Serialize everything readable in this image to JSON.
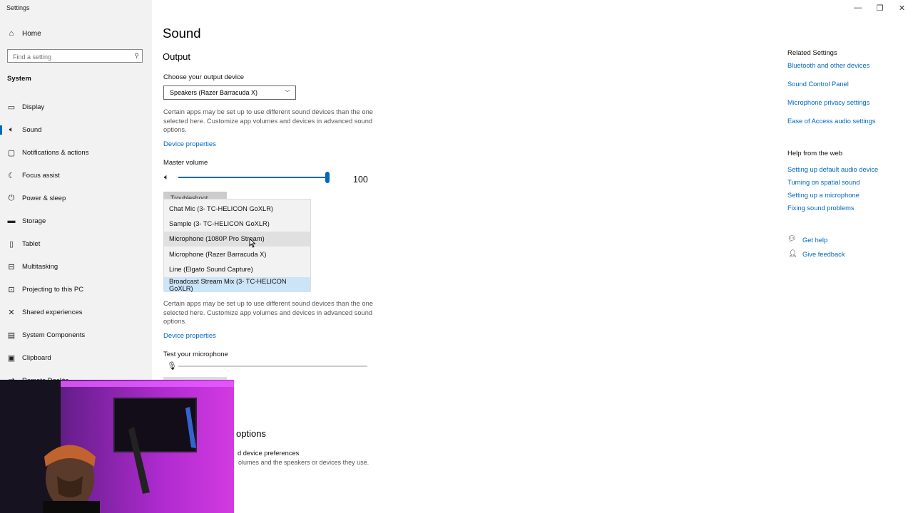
{
  "window": {
    "title": "Settings",
    "controls": {
      "minimize": "—",
      "restore": "❐",
      "close": "✕"
    }
  },
  "sidebar": {
    "home": {
      "icon": "home-icon",
      "label": "Home"
    },
    "search": {
      "placeholder": "Find a setting",
      "icon": "search-icon"
    },
    "section": "System",
    "items": [
      {
        "icon": "display-icon",
        "label": "Display"
      },
      {
        "icon": "sound-icon",
        "label": "Sound",
        "active": true
      },
      {
        "icon": "notifications-icon",
        "label": "Notifications & actions"
      },
      {
        "icon": "focus-assist-icon",
        "label": "Focus assist"
      },
      {
        "icon": "power-icon",
        "label": "Power & sleep"
      },
      {
        "icon": "storage-icon",
        "label": "Storage"
      },
      {
        "icon": "tablet-icon",
        "label": "Tablet"
      },
      {
        "icon": "multitasking-icon",
        "label": "Multitasking"
      },
      {
        "icon": "projecting-icon",
        "label": "Projecting to this PC"
      },
      {
        "icon": "shared-experiences-icon",
        "label": "Shared experiences"
      },
      {
        "icon": "system-components-icon",
        "label": "System Components"
      },
      {
        "icon": "clipboard-icon",
        "label": "Clipboard"
      },
      {
        "icon": "remote-desktop-icon",
        "label": "Remote Deskto"
      }
    ]
  },
  "main": {
    "title": "Sound",
    "output": {
      "heading": "Output",
      "device_label": "Choose your output device",
      "device_value": "Speakers (Razer Barracuda X)",
      "description": "Certain apps may be set up to use different sound devices than the one selected here. Customize app volumes and devices in advanced sound options.",
      "device_properties": "Device properties",
      "master_volume_label": "Master volume",
      "master_volume_value": "100",
      "master_volume_level": 1.0,
      "troubleshoot_label": "Troubleshoot"
    },
    "input_dropdown": {
      "options": [
        "Chat Mic (3- TC-HELICON GoXLR)",
        "Sample (3- TC-HELICON GoXLR)",
        "Microphone (1080P Pro Stream)",
        "Microphone (Razer Barracuda X)",
        "Line (Elgato Sound Capture)",
        "Broadcast Stream Mix (3- TC-HELICON GoXLR)"
      ],
      "hovered_index": 2,
      "selected_index": 5
    },
    "input": {
      "description": "Certain apps may be set up to use different sound devices than the one selected here. Customize app volumes and devices in advanced sound options.",
      "device_properties": "Device properties",
      "test_label": "Test your microphone",
      "test_level": 0.0
    },
    "advanced": {
      "title": "options",
      "subtitle": "d device preferences",
      "description": "olumes and the speakers or devices they use."
    }
  },
  "related": {
    "related_settings_heading": "Related Settings",
    "related_links": [
      "Bluetooth and other devices",
      "Sound Control Panel",
      "Microphone privacy settings",
      "Ease of Access audio settings"
    ],
    "help_heading": "Help from the web",
    "help_links": [
      "Setting up default audio device",
      "Turning on spatial sound",
      "Setting up a microphone",
      "Fixing sound problems"
    ],
    "get_help": "Get help",
    "give_feedback": "Give feedback"
  },
  "overlay": {
    "webcam_icon": "webcam-feed",
    "colors": {
      "accent": "#0067c0",
      "neon": "#c43bff"
    }
  }
}
